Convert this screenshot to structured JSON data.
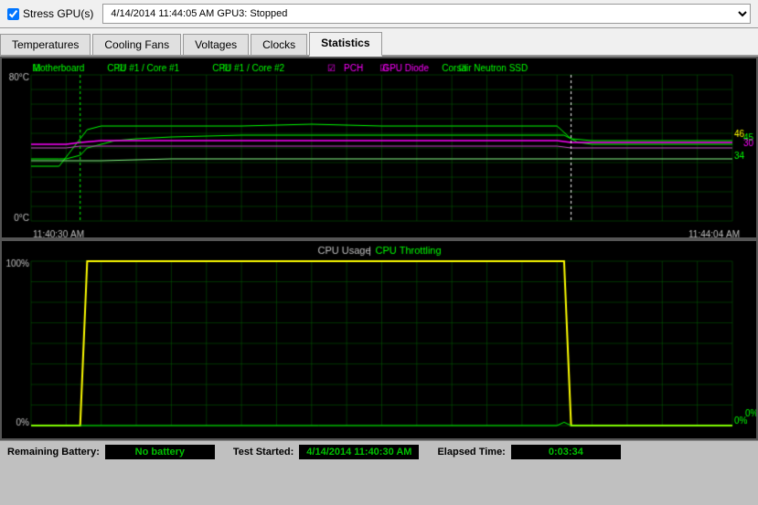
{
  "topbar": {
    "stress_gpu_label": "Stress GPU(s)",
    "log_entry": "4/14/2014 11:44:05 AM        GPU3: Stopped"
  },
  "tabs": [
    {
      "label": "Temperatures",
      "active": false
    },
    {
      "label": "Cooling Fans",
      "active": false
    },
    {
      "label": "Voltages",
      "active": false
    },
    {
      "label": "Clocks",
      "active": false
    },
    {
      "label": "Statistics",
      "active": true
    }
  ],
  "temp_chart": {
    "y_max": "80°C",
    "y_min": "0°C",
    "x_start": "11:40:30 AM",
    "x_end": "11:44:04 AM",
    "values_right": [
      "46",
      "45",
      "34",
      "30"
    ],
    "legend": [
      {
        "label": "Motherboard",
        "color": "#00ff00"
      },
      {
        "label": "CPU #1 / Core #1",
        "color": "#00ff00"
      },
      {
        "label": "CPU #1 / Core #2",
        "color": "#00ff00"
      },
      {
        "label": "PCH",
        "color": "#ff00ff"
      },
      {
        "label": "GPU Diode",
        "color": "#ff00ff"
      },
      {
        "label": "Corsair Neutron SSD",
        "color": "#00ff00"
      }
    ]
  },
  "cpu_chart": {
    "title_cpu_usage": "CPU Usage",
    "separator": "|",
    "title_cpu_throttling": "CPU Throttling",
    "y_max": "100%",
    "y_min": "0%",
    "value_right_1": "0%",
    "value_right_2": "0%"
  },
  "bottom_bar": {
    "remaining_battery_label": "Remaining Battery:",
    "remaining_battery_value": "No battery",
    "test_started_label": "Test Started:",
    "test_started_value": "4/14/2014 11:40:30 AM",
    "elapsed_time_label": "Elapsed Time:",
    "elapsed_time_value": "0:03:34"
  }
}
